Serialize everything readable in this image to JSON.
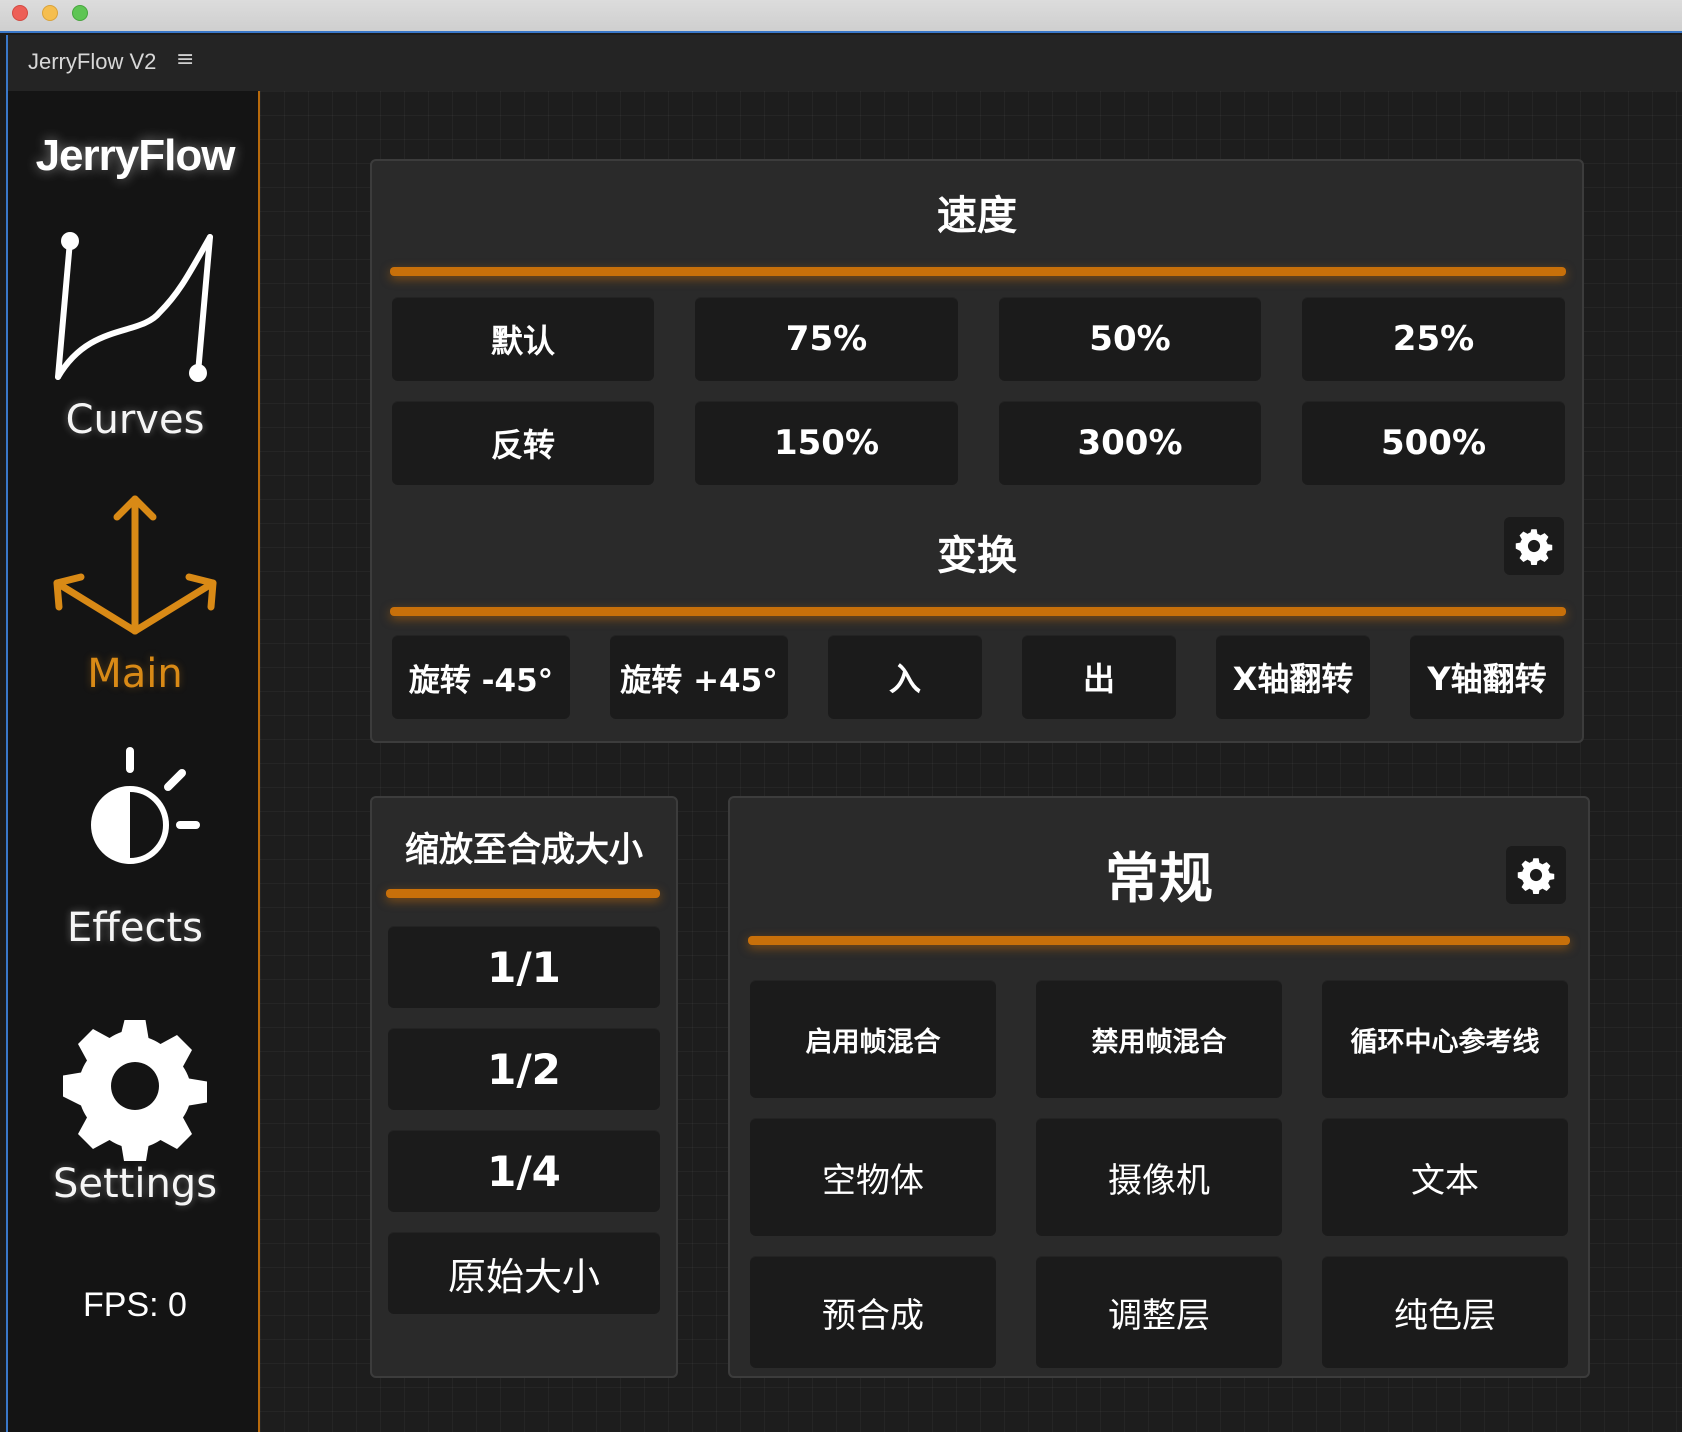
{
  "window": {
    "title": "JerryFlow V2",
    "menu_glyph": "≡"
  },
  "sidebar": {
    "brand": "JerryFlow",
    "items": [
      {
        "label": "Curves",
        "icon": "curve-icon",
        "active": false
      },
      {
        "label": "Main",
        "icon": "transform-arrows-icon",
        "active": true
      },
      {
        "label": "Effects",
        "icon": "half-moon-brightness-icon",
        "active": false
      },
      {
        "label": "Settings",
        "icon": "gear-icon",
        "active": false
      }
    ],
    "fps": "FPS: 0"
  },
  "speed": {
    "title": "速度",
    "row1": [
      "默认",
      "75%",
      "50%",
      "25%"
    ],
    "row2": [
      "反转",
      "150%",
      "300%",
      "500%"
    ]
  },
  "transform": {
    "title": "变换",
    "buttons": [
      "旋转 -45°",
      "旋转 +45°",
      "入",
      "出",
      "X轴翻转",
      "Y轴翻转"
    ]
  },
  "scale": {
    "title": "缩放至合成大小",
    "buttons": [
      "1/1",
      "1/2",
      "1/4",
      "原始大小"
    ]
  },
  "general": {
    "title": "常规",
    "buttons": [
      "启用帧混合",
      "禁用帧混合",
      "循环中心参考线",
      "空物体",
      "摄像机",
      "文本",
      "预合成",
      "调整层",
      "纯色层"
    ]
  },
  "colors": {
    "accent": "#c8700a",
    "active_nav": "#d98a16",
    "button_bg": "#1b1b1b",
    "card_bg": "#2a2a2a"
  }
}
